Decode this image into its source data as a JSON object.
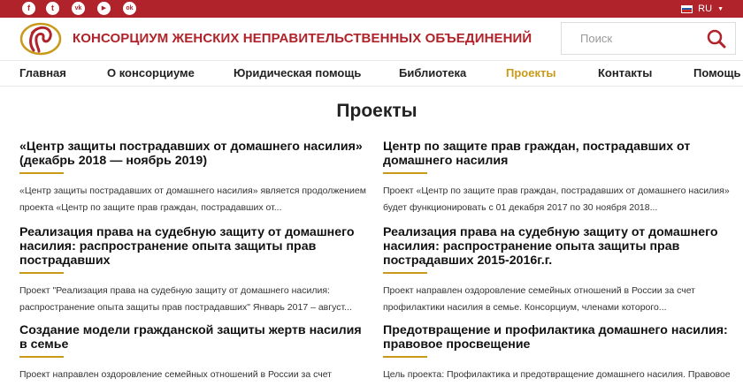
{
  "topbar": {
    "social": [
      {
        "name": "facebook-icon",
        "glyph": "f"
      },
      {
        "name": "twitter-icon",
        "glyph": "t"
      },
      {
        "name": "vk-icon",
        "glyph": "vk"
      },
      {
        "name": "youtube-icon",
        "glyph": "▶"
      },
      {
        "name": "odnoklassniki-icon",
        "glyph": "ok"
      }
    ],
    "lang": "RU"
  },
  "header": {
    "org_name": "КОНСОРЦИУМ ЖЕНСКИХ НЕПРАВИТЕЛЬСТВЕННЫХ ОБЪЕДИНЕНИЙ",
    "search_placeholder": "Поиск"
  },
  "nav": {
    "items": [
      {
        "label": "Главная"
      },
      {
        "label": "О консорциуме"
      },
      {
        "label": "Юридическая помощь"
      },
      {
        "label": "Библиотека"
      },
      {
        "label": "Проекты",
        "active": true
      },
      {
        "label": "Контакты"
      },
      {
        "label": "Помощь"
      }
    ]
  },
  "page": {
    "title": "Проекты",
    "projects": [
      {
        "title": "«Центр защиты пострадавших от домашнего насилия» (декабрь 2018 — ноябрь 2019)",
        "description": "«Центр защиты пострадавших от домашнего насилия» является продолжением проекта «Центр по защите прав граждан, пострадавших от..."
      },
      {
        "title": "Центр по защите прав граждан, пострадавших от домашнего насилия",
        "description": "Проект «Центр по защите прав граждан, пострадавших от домашнего насилия» будет функционировать с 01 декабря 2017 по 30 ноября 2018..."
      },
      {
        "title": "Реализация права на судебную защиту от домашнего насилия: распространение опыта защиты прав пострадавших",
        "description": "Проект \"Реализация права на судебную защиту от домашнего насилия: распространение опыта защиты прав пострадавших\" Январь 2017 – август..."
      },
      {
        "title": "Реализация права на судебную защиту от домашнего насилия: распространение опыта защиты прав пострадавших 2015-2016г.г.",
        "description": "Проект направлен оздоровление семейных отношений в России  за счет профилактики  насилия в семье. Консорциум, членами которого..."
      },
      {
        "title": "Создание модели гражданской защиты жертв насилия в семье",
        "description": "Проект направлен оздоровление семейных отношений в России  за счет профилактики насилия в семье. Он нацелен на создание эффективной"
      },
      {
        "title": "Предотвращение и профилактика домашнего насилия: правовое просвещение",
        "description": "Цель проекта: Профилактика и предотвращение домашнего насилия. Правовое просвещение населения о проблеме домашнего насилия, в том"
      }
    ]
  },
  "colors": {
    "brand_red": "#b0232a",
    "accent_gold": "#c99a1a"
  }
}
